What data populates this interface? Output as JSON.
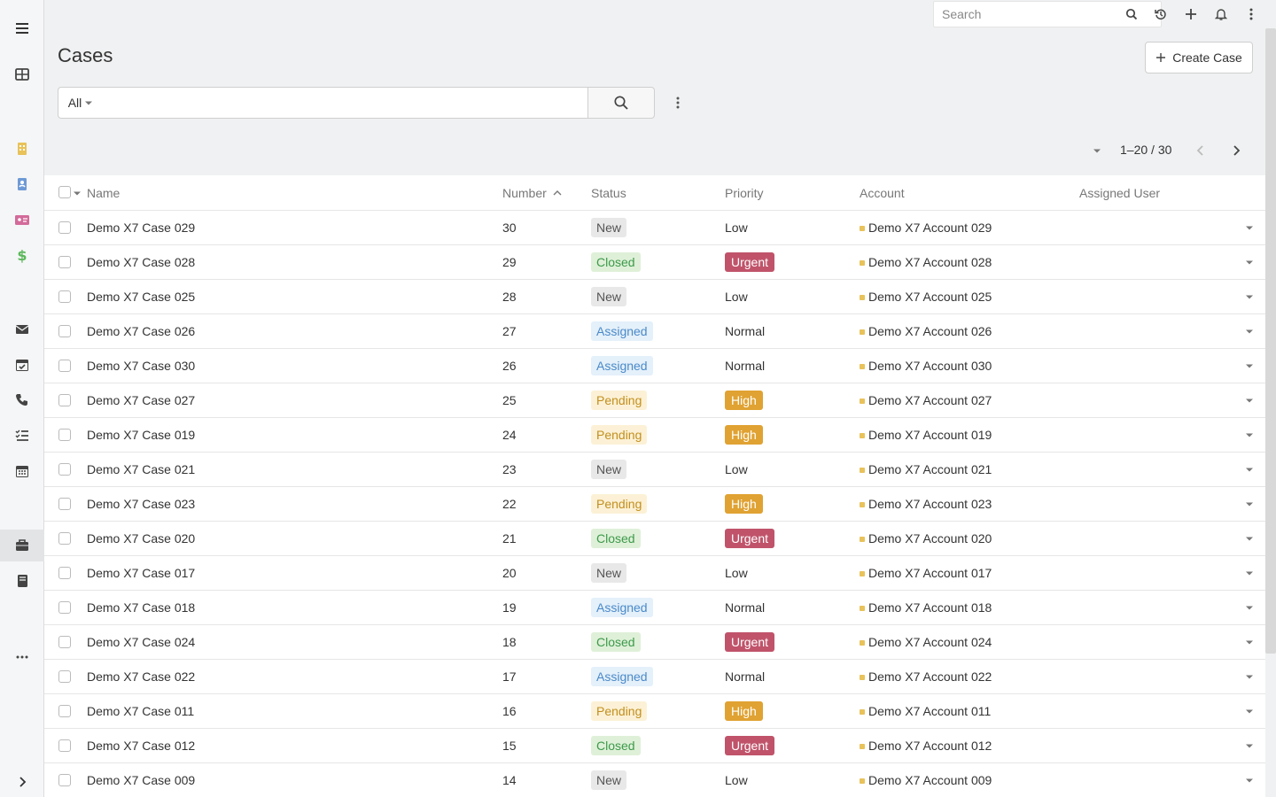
{
  "topbar": {
    "search_placeholder": "Search",
    "icons": [
      "search-icon",
      "history-icon",
      "plus-icon",
      "bell-icon",
      "kebab-icon"
    ]
  },
  "sidenav": {
    "icons": [
      "menu-icon",
      "grid-icon",
      "building-icon",
      "contact-icon",
      "id-card-icon",
      "dollar-icon",
      "envelope-icon",
      "calendar-check-icon",
      "phone-icon",
      "tasks-icon",
      "calendar-icon",
      "briefcase-icon",
      "book-icon",
      "more-icon",
      "chevron-right-icon"
    ],
    "active": "briefcase-icon"
  },
  "page": {
    "title": "Cases",
    "create_label": "Create Case"
  },
  "filter": {
    "select_value": "All",
    "text_value": ""
  },
  "pagination": {
    "label": "1–20 / 30"
  },
  "table": {
    "headers": {
      "name": "Name",
      "number": "Number",
      "status": "Status",
      "priority": "Priority",
      "account": "Account",
      "assigned_user": "Assigned User"
    },
    "sort": {
      "column": "number",
      "direction": "asc-indicator"
    },
    "rows": [
      {
        "name": "Demo X7 Case 029",
        "number": "30",
        "status": "New",
        "priority": "Low",
        "account": "Demo X7 Account 029",
        "assigned_user": ""
      },
      {
        "name": "Demo X7 Case 028",
        "number": "29",
        "status": "Closed",
        "priority": "Urgent",
        "account": "Demo X7 Account 028",
        "assigned_user": ""
      },
      {
        "name": "Demo X7 Case 025",
        "number": "28",
        "status": "New",
        "priority": "Low",
        "account": "Demo X7 Account 025",
        "assigned_user": ""
      },
      {
        "name": "Demo X7 Case 026",
        "number": "27",
        "status": "Assigned",
        "priority": "Normal",
        "account": "Demo X7 Account 026",
        "assigned_user": ""
      },
      {
        "name": "Demo X7 Case 030",
        "number": "26",
        "status": "Assigned",
        "priority": "Normal",
        "account": "Demo X7 Account 030",
        "assigned_user": ""
      },
      {
        "name": "Demo X7 Case 027",
        "number": "25",
        "status": "Pending",
        "priority": "High",
        "account": "Demo X7 Account 027",
        "assigned_user": ""
      },
      {
        "name": "Demo X7 Case 019",
        "number": "24",
        "status": "Pending",
        "priority": "High",
        "account": "Demo X7 Account 019",
        "assigned_user": ""
      },
      {
        "name": "Demo X7 Case 021",
        "number": "23",
        "status": "New",
        "priority": "Low",
        "account": "Demo X7 Account 021",
        "assigned_user": ""
      },
      {
        "name": "Demo X7 Case 023",
        "number": "22",
        "status": "Pending",
        "priority": "High",
        "account": "Demo X7 Account 023",
        "assigned_user": ""
      },
      {
        "name": "Demo X7 Case 020",
        "number": "21",
        "status": "Closed",
        "priority": "Urgent",
        "account": "Demo X7 Account 020",
        "assigned_user": ""
      },
      {
        "name": "Demo X7 Case 017",
        "number": "20",
        "status": "New",
        "priority": "Low",
        "account": "Demo X7 Account 017",
        "assigned_user": ""
      },
      {
        "name": "Demo X7 Case 018",
        "number": "19",
        "status": "Assigned",
        "priority": "Normal",
        "account": "Demo X7 Account 018",
        "assigned_user": ""
      },
      {
        "name": "Demo X7 Case 024",
        "number": "18",
        "status": "Closed",
        "priority": "Urgent",
        "account": "Demo X7 Account 024",
        "assigned_user": ""
      },
      {
        "name": "Demo X7 Case 022",
        "number": "17",
        "status": "Assigned",
        "priority": "Normal",
        "account": "Demo X7 Account 022",
        "assigned_user": ""
      },
      {
        "name": "Demo X7 Case 011",
        "number": "16",
        "status": "Pending",
        "priority": "High",
        "account": "Demo X7 Account 011",
        "assigned_user": ""
      },
      {
        "name": "Demo X7 Case 012",
        "number": "15",
        "status": "Closed",
        "priority": "Urgent",
        "account": "Demo X7 Account 012",
        "assigned_user": ""
      },
      {
        "name": "Demo X7 Case 009",
        "number": "14",
        "status": "New",
        "priority": "Low",
        "account": "Demo X7 Account 009",
        "assigned_user": ""
      }
    ]
  },
  "colors": {
    "accent_building": "#e8c25a",
    "accent_contact": "#6d9ad6",
    "accent_idcard": "#d36b9a",
    "accent_dollar": "#5cb85c",
    "urgent": "#c0536a",
    "high": "#e0a232"
  }
}
